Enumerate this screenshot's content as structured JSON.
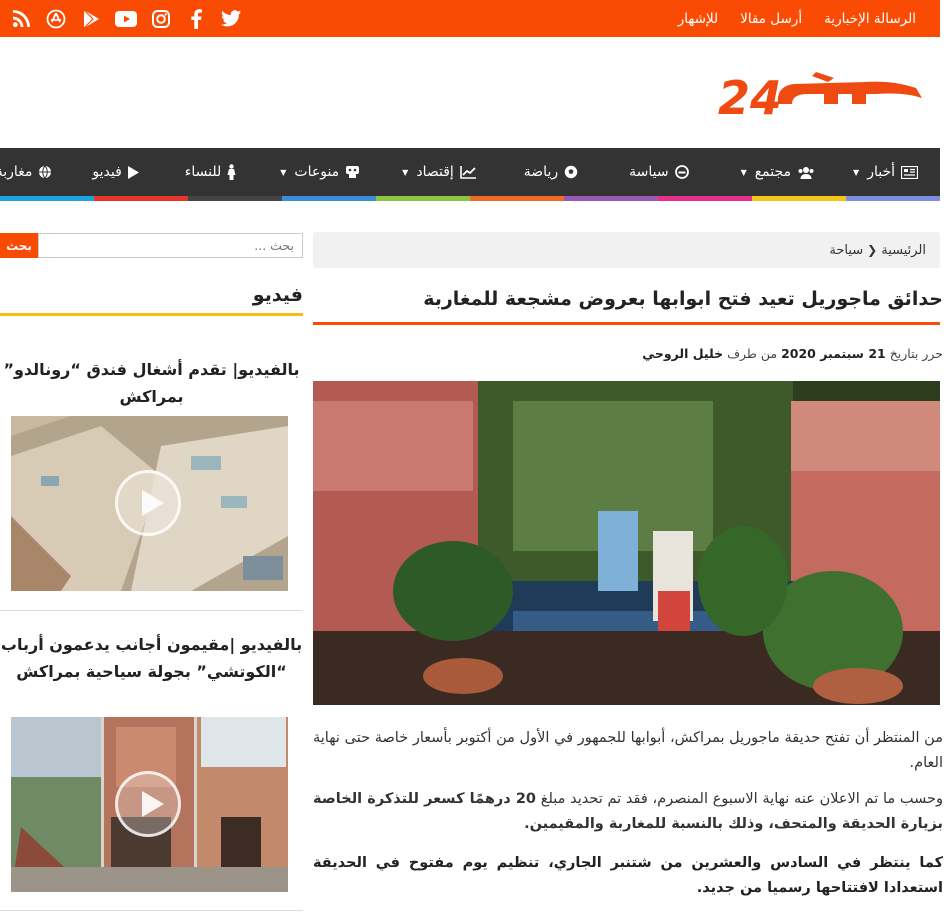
{
  "topbar": {
    "links": [
      "الرسالة الإخبارية",
      "أرسل مقالا",
      "للإشهار"
    ],
    "social_icons": [
      "rss-icon",
      "appstore-icon",
      "googleplay-icon",
      "youtube-icon",
      "instagram-icon",
      "facebook-icon",
      "twitter-icon"
    ]
  },
  "logo": {
    "text": "كشـ24"
  },
  "nav": {
    "items": [
      {
        "label": "أخبار",
        "icon": "newspaper-icon",
        "dropdown": true
      },
      {
        "label": "مجتمع",
        "icon": "users-icon",
        "dropdown": true
      },
      {
        "label": "سياسة",
        "icon": "political-icon",
        "dropdown": false
      },
      {
        "label": "رياضة",
        "icon": "soccer-ball-icon",
        "dropdown": false
      },
      {
        "label": "إقتصاد",
        "icon": "chart-icon",
        "dropdown": true
      },
      {
        "label": "منوعات",
        "icon": "gamepad-icon",
        "dropdown": true
      },
      {
        "label": "للنساء",
        "icon": "female-icon",
        "dropdown": false
      },
      {
        "label": "فيديو",
        "icon": "play-icon",
        "dropdown": false
      },
      {
        "label": "مغاربة العالم",
        "icon": "globe-icon",
        "dropdown": false
      }
    ],
    "stripe_colors": [
      "#1fa3e0",
      "#e8352a",
      "#444444",
      "#3a8ed6",
      "#8cc63f",
      "#f06a2a",
      "#9b59b6",
      "#e8308a",
      "#f5c518",
      "#7e8de0"
    ]
  },
  "breadcrumb": {
    "home": "الرئيسية",
    "current": "سياحة"
  },
  "article": {
    "title": "حدائق ماجوريل تعيد فتح ابوابها بعروض مشجعة للمغاربة",
    "meta_prefix": "حرر بتاريخ",
    "date": "21 سبتمبر 2020",
    "by": "من طرف",
    "author": "خليل الروحي",
    "p1": "من المنتظر أن تفتح حديقة ماجوريل بمراكش، أبوابها للجمهور في الأول من أكتوبر بأسعار خاصة حتى نهاية العام.",
    "p2_a": "وحسب ما تم الاعلان عنه نهاية الاسبوع المنصرم، فقد تم تحديد مبلغ",
    "p2_b": "20 درهمًا كسعر للتذكرة الخاصة بزيارة الحديقة والمتحف، وذلك بالنسبة للمغاربة والمقيمين.",
    "p3": "كما ينتظر في السادس والعشرين من شتنبر الجاري، تنظيم يوم مفتوح في الحديقة استعدادا لافتتاحها رسميا من جديد."
  },
  "sidebar": {
    "search_placeholder": "بحث ...",
    "search_button": "بحث",
    "heading": "فيديو",
    "videos": [
      {
        "title": "بالفيديو| تقدم أشغال فندق “رونالدو” بمراكش"
      },
      {
        "title": "بالفيديو |مقيمون أجانب يدعمون أرباب “الكوتشي” بجولة سياحية بمراكش"
      }
    ]
  },
  "colors": {
    "brand": "#fa4b05",
    "nav_bg": "#333333",
    "video_rule": "#f5bd16"
  }
}
